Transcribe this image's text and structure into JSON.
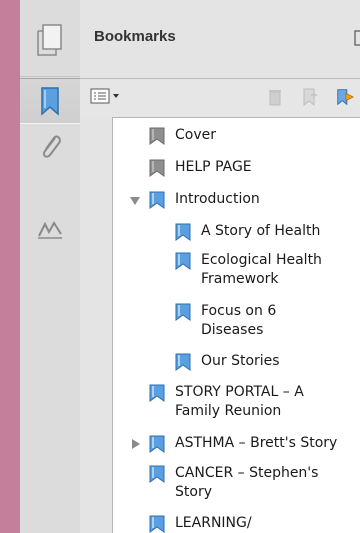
{
  "panel": {
    "title": "Bookmarks"
  },
  "bookmarks": [
    {
      "label": "Cover"
    },
    {
      "label": "HELP PAGE"
    },
    {
      "label": "Introduction",
      "expanded": true
    },
    {
      "label": "A Story of Health"
    },
    {
      "label": "Ecological Health Framework"
    },
    {
      "label": "Focus on 6 Diseases"
    },
    {
      "label": "Our Stories"
    },
    {
      "label": "STORY PORTAL – A Family Reunion"
    },
    {
      "label": "ASTHMA – Brett's Story",
      "expanded": false
    },
    {
      "label": "CANCER – Stephen's Story"
    },
    {
      "label": "LEARNING/"
    }
  ],
  "icons": {
    "rail": [
      "pages-icon",
      "bookmark-icon",
      "paperclip-icon",
      "signature-icon"
    ],
    "toolbar": [
      "options-menu-icon",
      "delete-icon",
      "new-bookmark-icon",
      "expand-bookmark-icon"
    ]
  },
  "colors": {
    "background": "#c47f9a",
    "bookmark_blue": "#4a90d9"
  }
}
